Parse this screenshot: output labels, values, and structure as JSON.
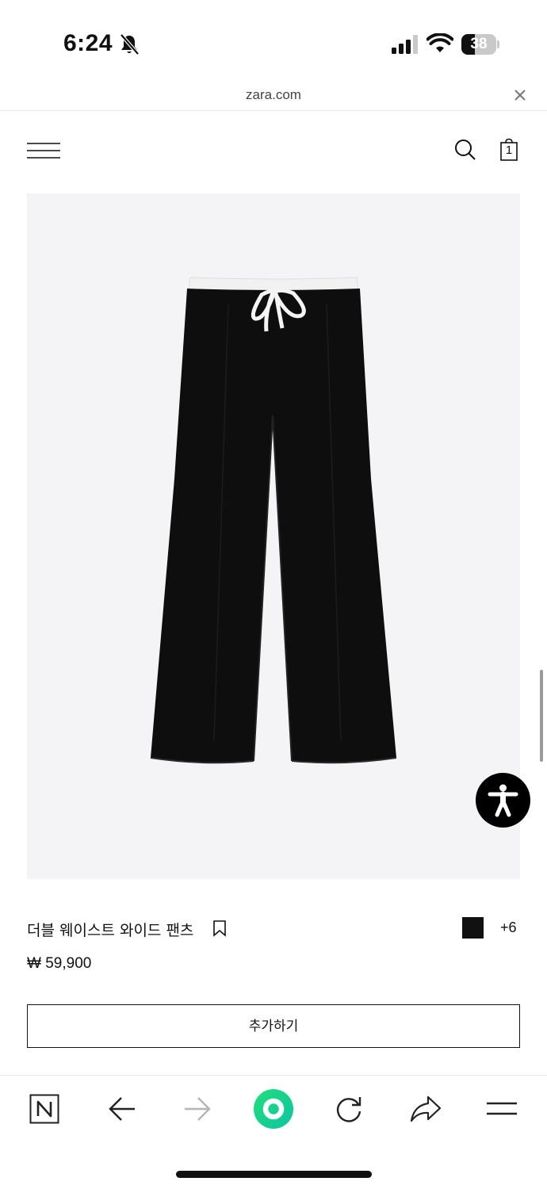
{
  "status_bar": {
    "time": "6:24",
    "battery_level": "38",
    "battery_fraction": 0.38
  },
  "browser": {
    "url": "zara.com",
    "close_icon": "close-icon"
  },
  "header": {
    "menu_icon": "hamburger-menu-icon",
    "search_icon": "search-icon",
    "cart_icon": "shopping-bag-icon",
    "cart_count": "1"
  },
  "product": {
    "name": "더블 웨이스트 와이드 팬츠",
    "price": "₩ 59,900",
    "color_swatch": "#111111",
    "more_colors": "+6",
    "add_button_label": "추가하기",
    "image_background": "#f4f4f6"
  },
  "toolbar": {
    "items": [
      "n-tab-icon",
      "back-arrow-icon",
      "forward-arrow-icon",
      "green-home-icon",
      "reload-icon",
      "share-icon",
      "menu-icon"
    ],
    "accent": "#1fd37a"
  },
  "accessibility": {
    "icon": "accessibility-icon"
  }
}
